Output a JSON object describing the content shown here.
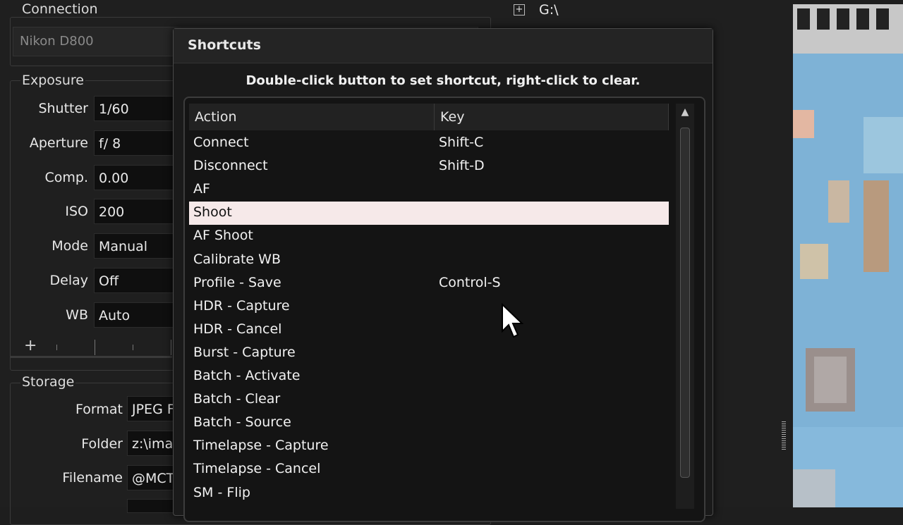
{
  "connection": {
    "title": "Connection",
    "camera": "Nikon D800"
  },
  "exposure": {
    "title": "Exposure",
    "fields": [
      {
        "label": "Shutter",
        "value": "1/60"
      },
      {
        "label": "Aperture",
        "value": "f/ 8"
      },
      {
        "label": "Comp.",
        "value": "0.00"
      },
      {
        "label": "ISO",
        "value": "200"
      },
      {
        "label": "Mode",
        "value": "Manual"
      },
      {
        "label": "Delay",
        "value": "Off"
      },
      {
        "label": "WB",
        "value": "Auto"
      }
    ],
    "add_label": "+"
  },
  "storage": {
    "title": "Storage",
    "fields": [
      {
        "label": "Format",
        "value": "JPEG F"
      },
      {
        "label": "Folder",
        "value": "z:\\ima"
      },
      {
        "label": "Filename",
        "value": "@MCT"
      }
    ]
  },
  "tree": {
    "expander": "+",
    "drive": "G:\\"
  },
  "dialog": {
    "title": "Shortcuts",
    "hint": "Double-click button to set shortcut, right-click to clear.",
    "columns": {
      "action": "Action",
      "key": "Key"
    },
    "rows": [
      {
        "action": "Connect",
        "key": "Shift-C"
      },
      {
        "action": "Disconnect",
        "key": "Shift-D"
      },
      {
        "action": "AF",
        "key": ""
      },
      {
        "action": "Shoot",
        "key": ""
      },
      {
        "action": "AF Shoot",
        "key": ""
      },
      {
        "action": "Calibrate WB",
        "key": ""
      },
      {
        "action": "Profile - Save",
        "key": "Control-S"
      },
      {
        "action": "HDR - Capture",
        "key": ""
      },
      {
        "action": "HDR - Cancel",
        "key": ""
      },
      {
        "action": "Burst - Capture",
        "key": ""
      },
      {
        "action": "Batch - Activate",
        "key": ""
      },
      {
        "action": "Batch - Clear",
        "key": ""
      },
      {
        "action": "Batch - Source",
        "key": ""
      },
      {
        "action": "Timelapse - Capture",
        "key": ""
      },
      {
        "action": "Timelapse - Cancel",
        "key": ""
      },
      {
        "action": "SM - Flip",
        "key": ""
      }
    ],
    "selected_row": 3,
    "scroll_up_glyph": "▲"
  },
  "colors": {
    "selected_row": "#f6e9e9",
    "panel_bg": "#1f1f1f",
    "input_bg": "#0f0f0f"
  }
}
